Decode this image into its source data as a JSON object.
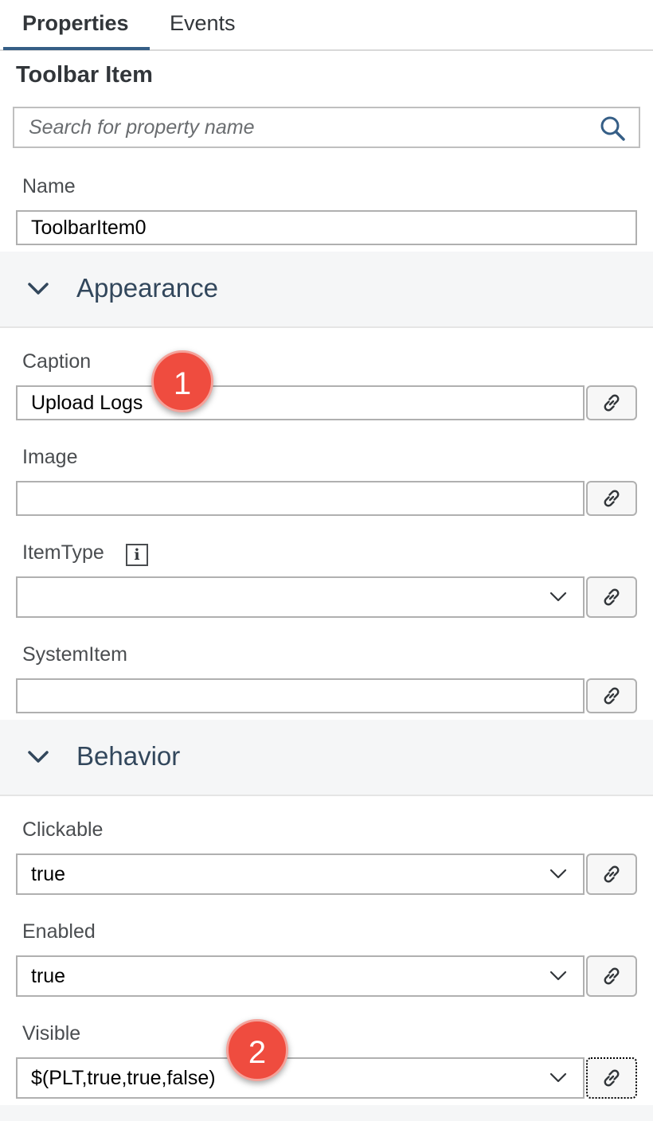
{
  "tabs": {
    "properties": "Properties",
    "events": "Events"
  },
  "panel_title": "Toolbar Item",
  "search": {
    "placeholder": "Search for property name",
    "value": ""
  },
  "name_field": {
    "label": "Name",
    "value": "ToolbarItem0"
  },
  "sections": {
    "appearance": "Appearance",
    "behavior": "Behavior"
  },
  "appearance": {
    "caption": {
      "label": "Caption",
      "value": "Upload Logs"
    },
    "image": {
      "label": "Image",
      "value": ""
    },
    "itemtype": {
      "label": "ItemType",
      "value": "",
      "info_glyph": "i"
    },
    "systemitem": {
      "label": "SystemItem",
      "value": ""
    }
  },
  "behavior": {
    "clickable": {
      "label": "Clickable",
      "value": "true"
    },
    "enabled": {
      "label": "Enabled",
      "value": "true"
    },
    "visible": {
      "label": "Visible",
      "value": "$(PLT,true,true,false)"
    }
  },
  "badges": {
    "one": "1",
    "two": "2"
  },
  "colors": {
    "accent": "#355e86",
    "badge": "#ef4c3f",
    "section_bg": "#f5f6f7",
    "section_title": "#32475c"
  },
  "icons": {
    "search": "search-icon",
    "link": "link-icon",
    "chevron": "chevron-down-icon",
    "info": "info-icon"
  }
}
